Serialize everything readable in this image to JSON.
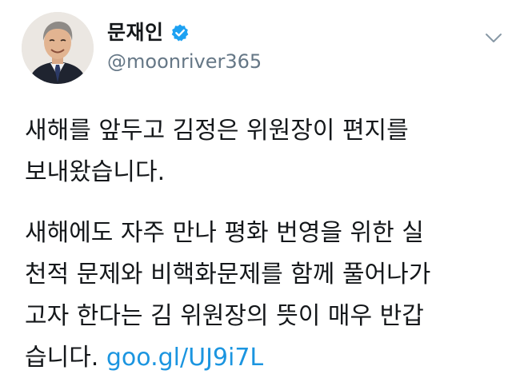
{
  "tweet": {
    "display_name": "문재인",
    "handle": "@moonriver365",
    "verified": true,
    "paragraph1": {
      "line1": "새해를 앞두고 김정은 위원장이 편지를",
      "line2": "보내왔습니다."
    },
    "paragraph2": {
      "line1": "새해에도 자주 만나 평화 번영을 위한 실",
      "line2": "천적 문제와 비핵화문제를 함께 풀어나가",
      "line3": "고자 한다는 김 위원장의 뜻이 매우 반갑",
      "line4_text": "습니다. ",
      "link_text": "goo.gl/UJ9i7L"
    }
  },
  "icons": {
    "verified": "verified-badge-icon",
    "caret": "chevron-down-icon"
  },
  "colors": {
    "text": "#14171a",
    "secondary": "#657786",
    "link": "#1b95e0",
    "verified": "#1da1f2"
  }
}
